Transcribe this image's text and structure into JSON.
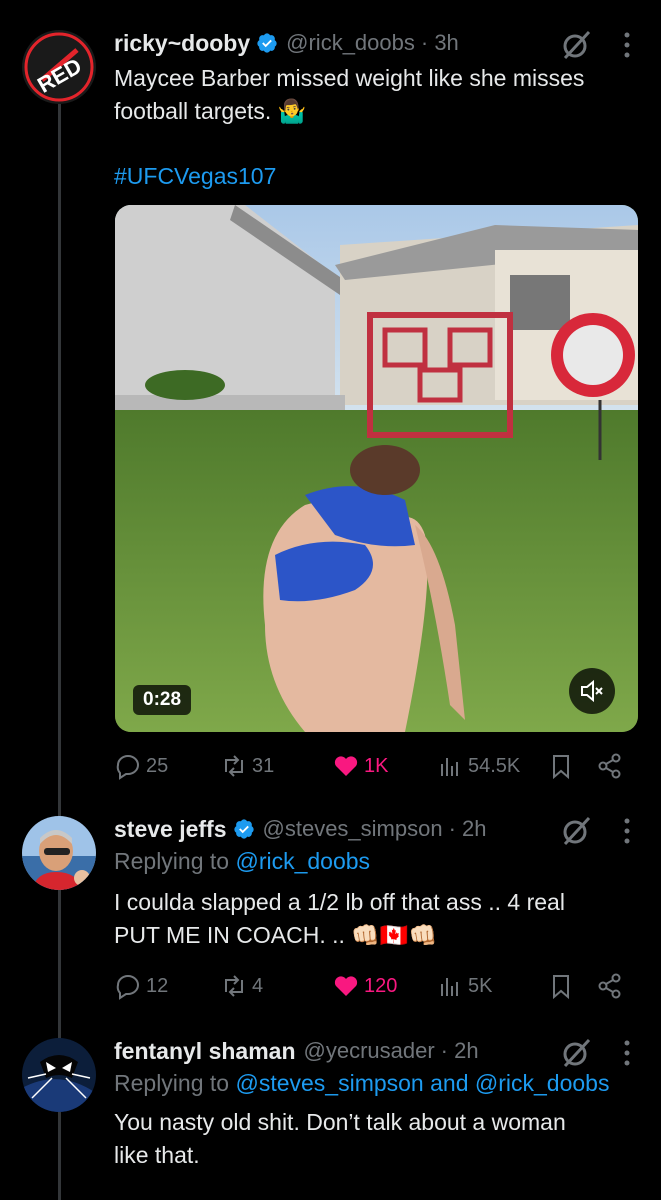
{
  "tweets": [
    {
      "name": "ricky~dooby",
      "handle": "@rick_doobs",
      "time": "· 3h",
      "verified": true,
      "avatar_text": "RED",
      "text_line1": "Maycee Barber missed weight like she misses",
      "text_line2": "football targets. 🤷‍♂️",
      "hashtag": "#UFCVegas107",
      "video_duration": "0:28",
      "replies": "25",
      "reposts": "31",
      "likes": "1K",
      "views": "54.5K"
    },
    {
      "name": "steve jeffs",
      "handle": "@steves_simpson",
      "time": "· 2h",
      "verified": true,
      "replying_prefix": "Replying to",
      "replying_to": "@rick_doobs",
      "text_line1": "I coulda slapped a 1/2 lb off that ass .. 4 real",
      "text_line2": "PUT ME IN COACH. .. 👊🏻🇨🇦👊🏻",
      "replies": "12",
      "reposts": "4",
      "likes": "120",
      "views": "5K"
    },
    {
      "name": "fentanyl shaman",
      "handle": "@yecrusader",
      "time": "· 2h",
      "verified": false,
      "replying_prefix": "Replying to",
      "replying_to": "@steves_simpson and @rick_doobs",
      "text_line1": "You nasty old shit. Don’t talk about a woman",
      "text_line2": "like that."
    }
  ],
  "colors": {
    "background": "#000000",
    "text": "#e7e9ea",
    "secondary": "#71767b",
    "link": "#1d9bf0",
    "like": "#f91880",
    "verified": "#1d9bf0"
  },
  "icons": [
    "grok-icon",
    "more-icon",
    "reply-icon",
    "repost-icon",
    "like-icon",
    "views-icon",
    "bookmark-icon",
    "share-icon",
    "mute-icon",
    "verified-icon"
  ]
}
